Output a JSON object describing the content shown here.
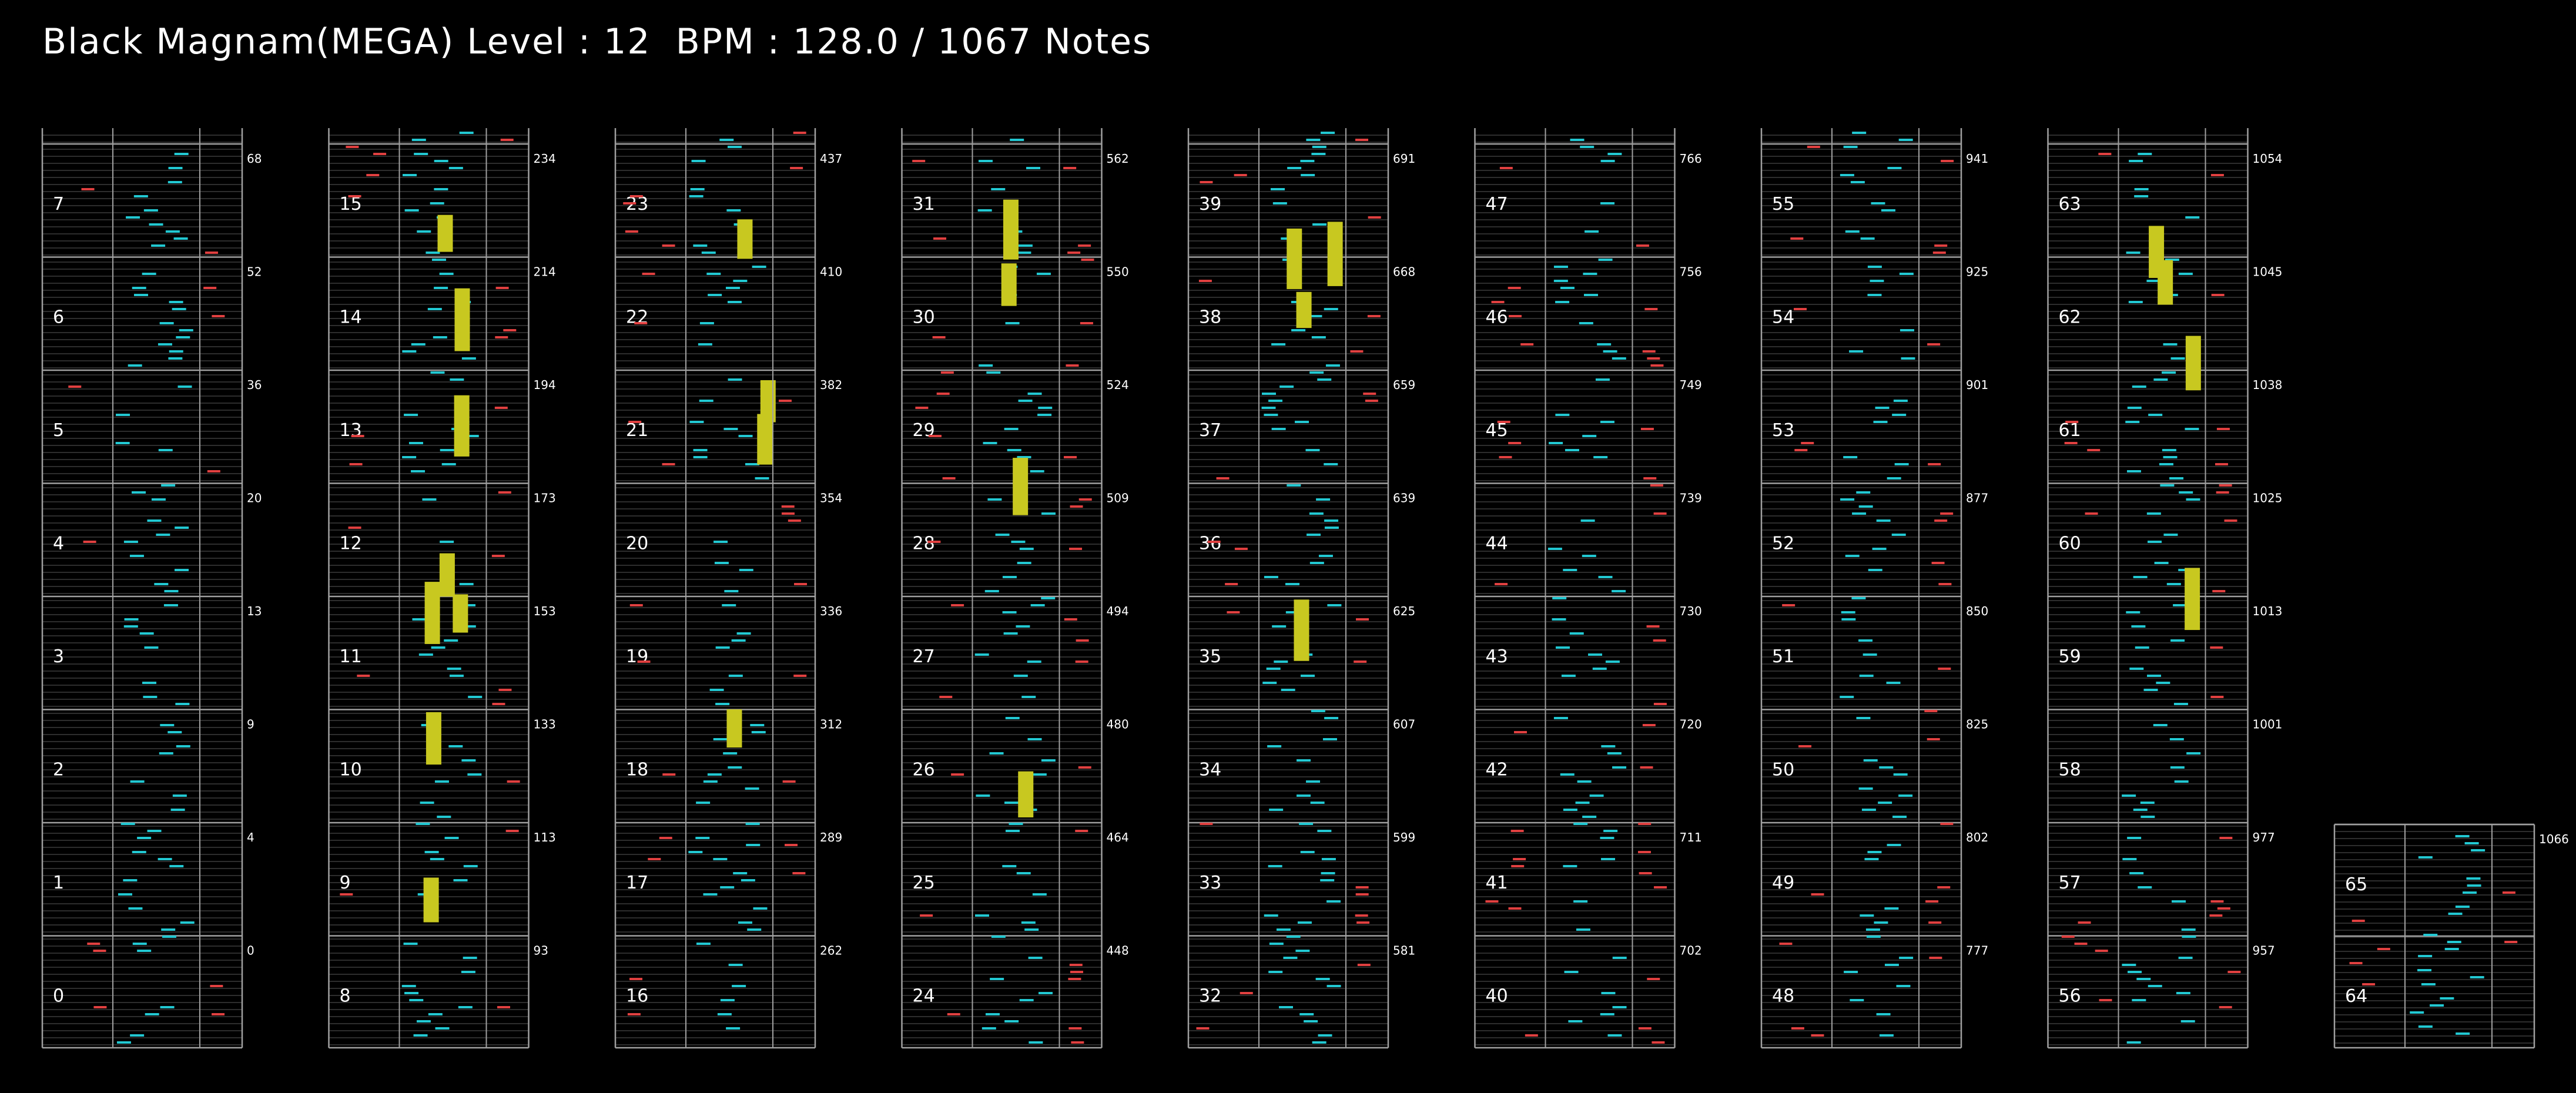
{
  "header": {
    "title": "Black Magnam(MEGA) Level : 12  BPM : 128.0 / 1067 Notes"
  },
  "chart": {
    "columns": [
      {
        "measures": [
          7,
          6,
          5,
          4,
          3,
          2,
          1,
          0
        ],
        "counts": [
          "68",
          "52",
          "36",
          "20",
          "13",
          "9",
          "4",
          "0"
        ]
      },
      {
        "measures": [
          15,
          14,
          13,
          12,
          11,
          10,
          9,
          8
        ],
        "counts": [
          "234",
          "214",
          "194",
          "173",
          "153",
          "133",
          "113",
          "93"
        ]
      },
      {
        "measures": [
          23,
          22,
          21,
          20,
          19,
          18,
          17,
          16
        ],
        "counts": [
          "437",
          "410",
          "382",
          "354",
          "336",
          "312",
          "289",
          "262"
        ]
      },
      {
        "measures": [
          31,
          30,
          29,
          28,
          27,
          26,
          25,
          24
        ],
        "counts": [
          "562",
          "550",
          "524",
          "509",
          "494",
          "480",
          "464",
          "448"
        ]
      },
      {
        "measures": [
          39,
          38,
          37,
          36,
          35,
          34,
          33,
          32
        ],
        "counts": [
          "691",
          "668",
          "659",
          "639",
          "625",
          "607",
          "599",
          "581"
        ]
      },
      {
        "measures": [
          47,
          46,
          45,
          44,
          43,
          42,
          41,
          40
        ],
        "counts": [
          "766",
          "756",
          "749",
          "739",
          "730",
          "720",
          "711",
          "702"
        ]
      },
      {
        "measures": [
          55,
          54,
          53,
          52,
          51,
          50,
          49,
          48
        ],
        "counts": [
          "941",
          "925",
          "901",
          "877",
          "850",
          "825",
          "802",
          "777"
        ]
      },
      {
        "measures": [
          63,
          62,
          61,
          60,
          59,
          58,
          57,
          56
        ],
        "counts": [
          "1054",
          "1045",
          "1038",
          "1025",
          "1013",
          "1001",
          "977",
          "957"
        ]
      },
      {
        "measures": [
          65,
          64
        ],
        "counts": [
          "1066"
        ]
      }
    ],
    "colors": {
      "lines": "#a0a0a0",
      "grid": "#3c3c3c",
      "cyan": "#22c8d2",
      "red": "#e04040",
      "yellow": "#c8c820"
    }
  }
}
